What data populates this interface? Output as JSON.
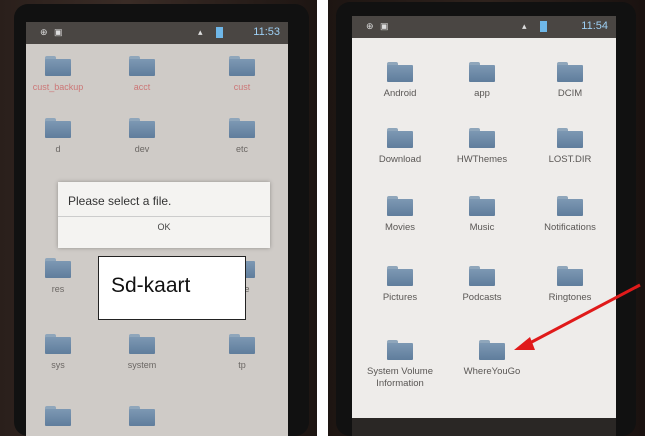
{
  "left_screen": {
    "status_time": "11:53",
    "folders": [
      "cust_backup",
      "acct",
      "cust",
      "d",
      "dev",
      "etc",
      "res",
      "age",
      "sys",
      "system",
      "tp"
    ],
    "dialog": {
      "message": "Please select a file.",
      "ok": "OK"
    },
    "callout": "Sd-kaart"
  },
  "right_screen": {
    "status_time": "11:54",
    "folders": [
      "Android",
      "app",
      "DCIM",
      "Download",
      "HWThemes",
      "LOST.DIR",
      "Movies",
      "Music",
      "Notifications",
      "Pictures",
      "Podcasts",
      "Ringtones",
      "System Volume Information",
      "WhereYouGo"
    ]
  },
  "colors": {
    "arrow": "#e01a1a",
    "folder": "#6f8ba8",
    "status_time": "#9ed0f5"
  },
  "icons": [
    "folder-icon",
    "usb-icon",
    "wifi-icon",
    "battery-icon"
  ]
}
